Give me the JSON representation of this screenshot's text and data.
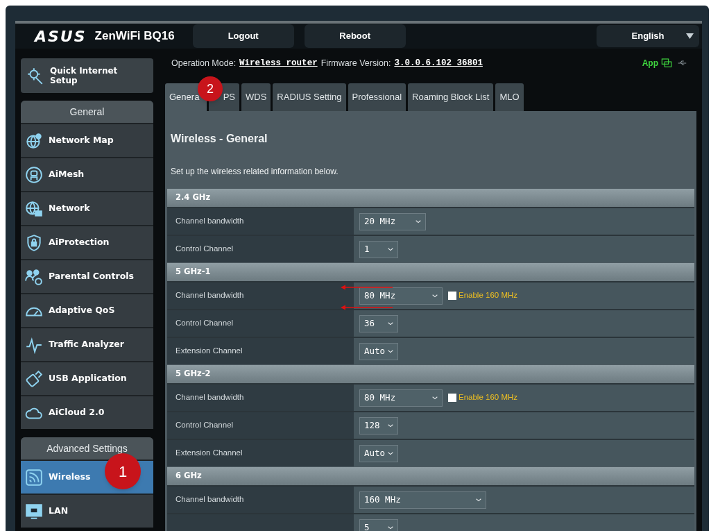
{
  "header": {
    "logo": "ASUS",
    "model": "ZenWiFi BQ16",
    "buttons": [
      "Logout",
      "Reboot"
    ],
    "language": "English"
  },
  "sidebar": {
    "quick_setup": "Quick Internet Setup",
    "sections": [
      {
        "title": "General",
        "items": [
          {
            "label": "Network Map",
            "selected": false
          },
          {
            "label": "AiMesh",
            "selected": false
          },
          {
            "label": "Network",
            "selected": false
          },
          {
            "label": "AiProtection",
            "selected": false
          },
          {
            "label": "Parental Controls",
            "selected": false
          },
          {
            "label": "Adaptive QoS",
            "selected": false
          },
          {
            "label": "Traffic Analyzer",
            "selected": false
          },
          {
            "label": "USB Application",
            "selected": false
          },
          {
            "label": "AiCloud 2.0",
            "selected": false
          }
        ]
      },
      {
        "title": "Advanced Settings",
        "items": [
          {
            "label": "Wireless",
            "selected": true
          },
          {
            "label": "LAN",
            "selected": false
          }
        ]
      }
    ]
  },
  "info": {
    "operation_mode_label": "Operation Mode:",
    "operation_mode": "Wireless router",
    "firmware_label": "Firmware Version:",
    "firmware": "3.0.0.6.102_36801",
    "app": "App"
  },
  "tabs": [
    {
      "label": "Genera",
      "selected": true
    },
    {
      "label": "PS",
      "selected": false
    },
    {
      "label": "WDS",
      "selected": false
    },
    {
      "label": "RADIUS Setting",
      "selected": false
    },
    {
      "label": "Professional",
      "selected": false
    },
    {
      "label": "Roaming Block List",
      "selected": false
    },
    {
      "label": "MLO",
      "selected": false
    }
  ],
  "panel": {
    "title": "Wireless - General",
    "description": "Set up the wireless related information below.",
    "sections": [
      {
        "title": "2.4 GHz",
        "rows": [
          {
            "label": "Channel bandwidth",
            "value": "20 MHz"
          },
          {
            "label": "Control Channel",
            "value": "1"
          }
        ]
      },
      {
        "title": "5 GHz-1",
        "rows": [
          {
            "label": "Channel bandwidth",
            "value": "80 MHz",
            "option": {
              "label": "Enable 160 MHz",
              "checked": false
            }
          },
          {
            "label": "Control Channel",
            "value": "36"
          },
          {
            "label": "Extension Channel",
            "value": "Auto"
          }
        ]
      },
      {
        "title": "5 GHz-2",
        "rows": [
          {
            "label": "Channel bandwidth",
            "value": "80 MHz",
            "option": {
              "label": "Enable 160 MHz",
              "checked": false
            }
          },
          {
            "label": "Control Channel",
            "value": "128"
          },
          {
            "label": "Extension Channel",
            "value": "Auto"
          }
        ]
      },
      {
        "title": "6 GHz",
        "rows": [
          {
            "label": "Channel bandwidth",
            "value": "160 MHz"
          },
          {
            "value": "5"
          }
        ]
      }
    ]
  },
  "annotations": [
    "2",
    "1"
  ]
}
